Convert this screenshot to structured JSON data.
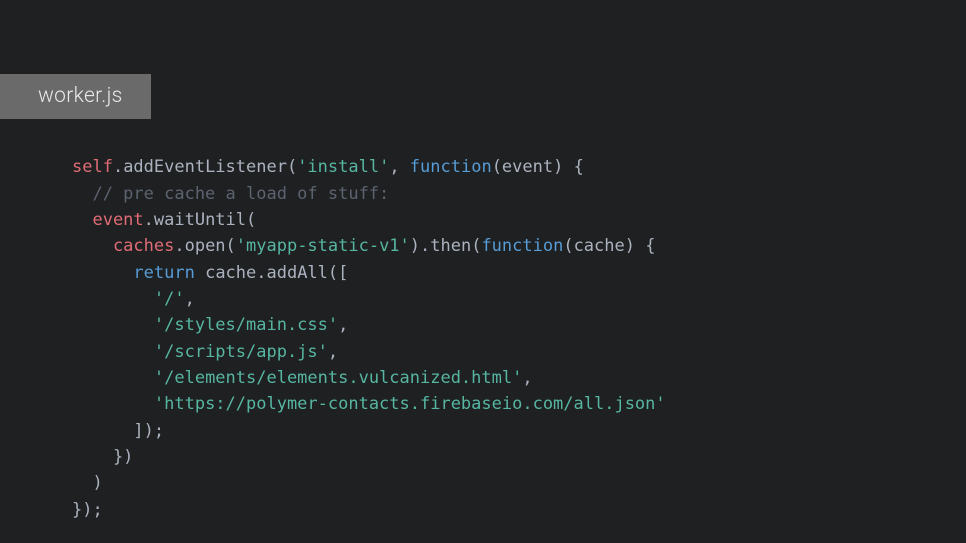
{
  "tab": {
    "filename": "worker.js"
  },
  "code": {
    "l1a": "self",
    "l1b": ".addEventListener(",
    "l1c": "'install'",
    "l1d": ", ",
    "l1e": "function",
    "l1f": "(event) {",
    "l2a": "  // pre cache a load of stuff:",
    "l3a": "  event",
    "l3b": ".waitUntil(",
    "l4a": "    caches",
    "l4b": ".open(",
    "l4c": "'myapp-static-v1'",
    "l4d": ").then(",
    "l4e": "function",
    "l4f": "(cache) {",
    "l5a": "      ",
    "l5b": "return",
    "l5c": " cache.addAll([",
    "l6a": "        ",
    "l6b": "'/'",
    "l6c": ",",
    "l7a": "        ",
    "l7b": "'/styles/main.css'",
    "l7c": ",",
    "l8a": "        ",
    "l8b": "'/scripts/app.js'",
    "l8c": ",",
    "l9a": "        ",
    "l9b": "'/elements/elements.vulcanized.html'",
    "l9c": ",",
    "l10a": "        ",
    "l10b": "'https://polymer-contacts.firebaseio.com/all.json'",
    "l11a": "      ]);",
    "l12a": "    })",
    "l13a": "  )",
    "l14a": "});"
  }
}
